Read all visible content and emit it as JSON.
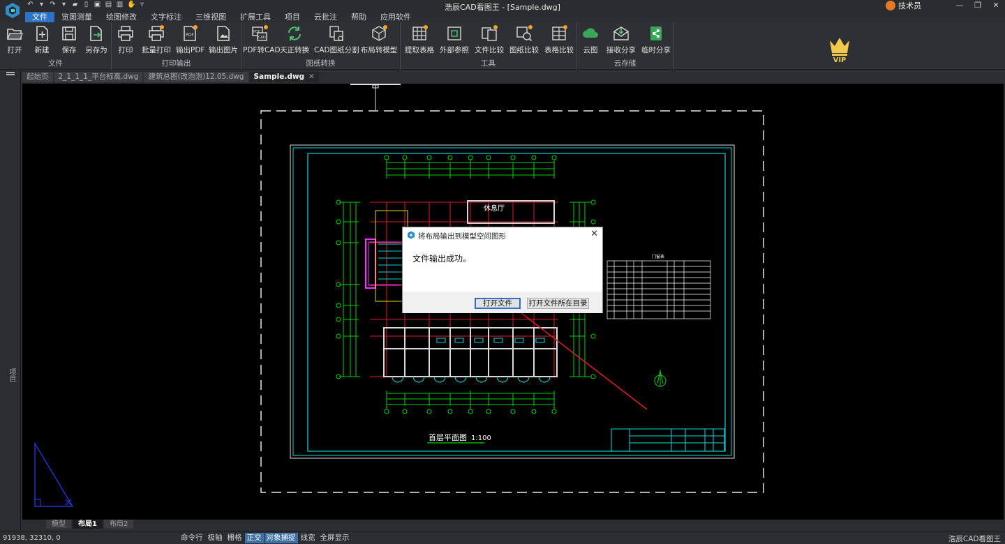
{
  "window": {
    "title": "浩辰CAD看图王 - [Sample.dwg]",
    "user": "技术员"
  },
  "menu": [
    "文件",
    "览图测量",
    "绘图修改",
    "文字标注",
    "三维视图",
    "扩展工具",
    "项目",
    "云批注",
    "帮助",
    "应用软件"
  ],
  "ribbon": {
    "groups": [
      {
        "label": "文件",
        "buttons": [
          "打开",
          "新建",
          "保存",
          "另存为"
        ]
      },
      {
        "label": "打印输出",
        "buttons": [
          "打印",
          "批量打印",
          "输出PDF",
          "输出图片"
        ]
      },
      {
        "label": "图纸转换",
        "buttons": [
          "PDF转CAD",
          "天正转换",
          "CAD图纸分割",
          "布局转模型"
        ]
      },
      {
        "label": "工具",
        "buttons": [
          "提取表格",
          "外部参照",
          "文件比较",
          "图纸比较",
          "表格比较"
        ]
      },
      {
        "label": "云存储",
        "buttons": [
          "云图",
          "接收分享",
          "临时分享"
        ]
      }
    ],
    "vip_label": "VIP"
  },
  "tabs": [
    "起始页",
    "2_1_1_1_平台标高.dwg",
    "建筑总图(改泡泡)12.05.dwg",
    "Sample.dwg"
  ],
  "sidebar_label": "项目",
  "drawing": {
    "room_label": "休息厅",
    "title": "首层平面图",
    "scale": "1:100",
    "table_title": "门窗表"
  },
  "layout_tabs": [
    "模型",
    "布局1",
    "布局2"
  ],
  "status": {
    "coords": "91938, 32310, 0",
    "buttons": [
      "命令行",
      "极轴",
      "栅格",
      "正交",
      "对象捕捉",
      "线宽",
      "全屏显示"
    ],
    "right": "浩辰CAD看图王"
  },
  "dialog": {
    "title": "将布局输出到模型空间图形",
    "message": "文件输出成功。",
    "open_file": "打开文件",
    "open_folder": "打开文件所在目录"
  },
  "colors": {
    "accent": "#2d73c4",
    "cyan": "#00d9d9",
    "green": "#00d200",
    "red": "#e0202a"
  }
}
